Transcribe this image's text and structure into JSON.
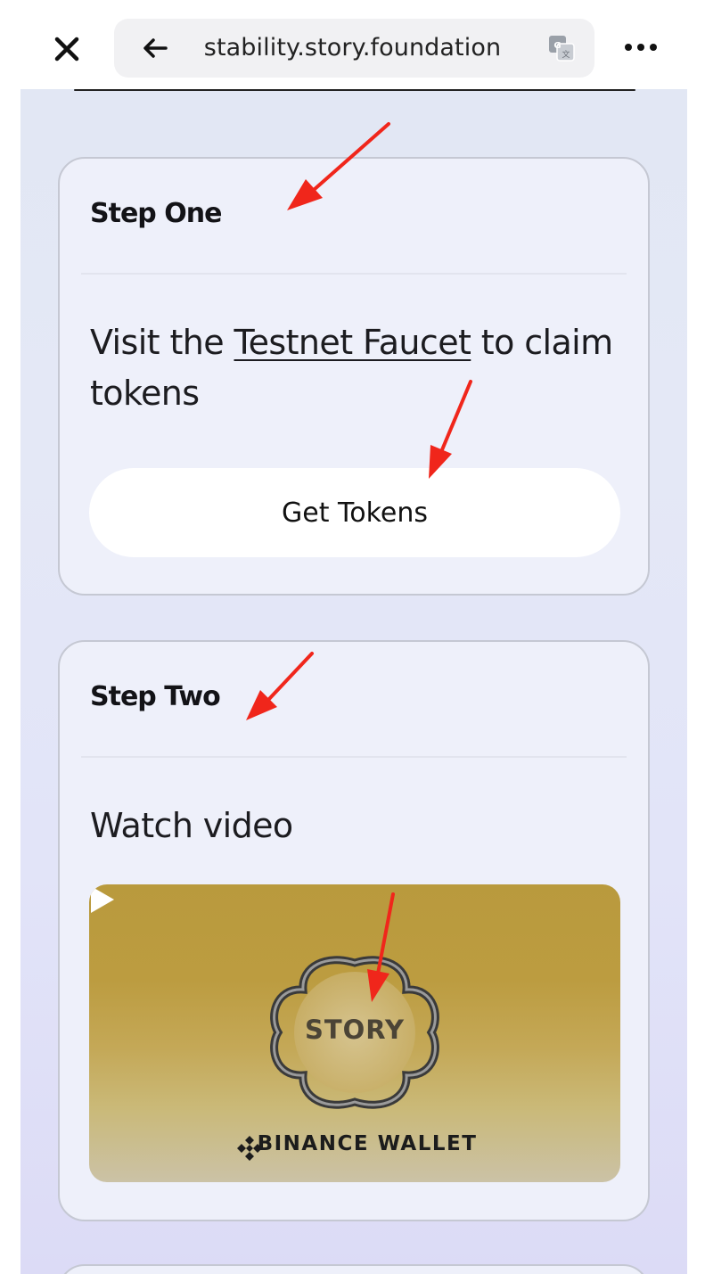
{
  "browser": {
    "url": "stability.story.foundation",
    "close_icon": "close-icon",
    "back_icon": "back-arrow-icon",
    "translate_icon": "translate-icon",
    "more_icon": "more-options-icon"
  },
  "step_one": {
    "title": "Step One",
    "text_before": "Visit the ",
    "link_text": "Testnet Faucet",
    "text_after": " to claim tokens",
    "button_label": "Get Tokens"
  },
  "step_two": {
    "title": "Step Two",
    "text": "Watch video",
    "video": {
      "logo_text": "STORY",
      "brand_text": "BINANCE WALLET",
      "play_icon": "play-icon"
    }
  },
  "annotations": {
    "arrow_color": "#f0261b",
    "count": 5
  },
  "colors": {
    "card_background": "#eef0fa",
    "page_background": "#e2e7f4",
    "video_gold": "#b99a3d"
  }
}
